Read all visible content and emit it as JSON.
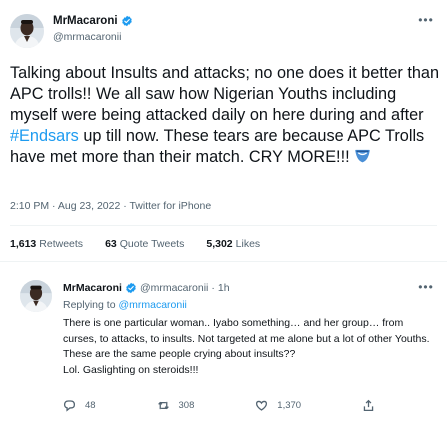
{
  "main_tweet": {
    "author": {
      "name": "MrMacaroni",
      "handle": "@mrmacaronii",
      "verified": true,
      "avatar": "profile-photo-man"
    },
    "text_segments": [
      "Talking about Insults and attacks; no one does it better than APC trolls!! We all saw how Nigerian Youths including myself were being attacked daily on here during and after ",
      "#Endsars",
      " up till now. These tears are because APC Trolls have met more than their match. CRY MORE!!! "
    ],
    "emoji": "crying-face-emoji",
    "timestamp": "2:10 PM · Aug 23, 2022 · Twitter for iPhone",
    "stats": {
      "retweets_count": "1,613",
      "retweets_label": "Retweets",
      "quote_count": "63",
      "quote_label": "Quote Tweets",
      "likes_count": "5,302",
      "likes_label": "Likes"
    }
  },
  "reply_tweet": {
    "author": {
      "name": "MrMacaroni",
      "handle": "@mrmacaronii",
      "time": "1h",
      "verified": true,
      "avatar": "profile-photo-man"
    },
    "replying_label": "Replying to",
    "replying_to": "@mrmacaronii",
    "text_lines": [
      "There is one particular woman.. Iyabo something… and her group… from curses, to attacks, to insults. Not targeted at me alone but a lot of other Youths.",
      "These are the same people crying about insults??",
      "Lol. Gaslighting on steroids!!!"
    ],
    "actions": {
      "replies": "48",
      "retweets": "308",
      "likes": "1,370"
    }
  },
  "colors": {
    "accent": "#1d9bf0",
    "text": "#0f1419",
    "secondary": "#536471",
    "divider": "#eff3f4"
  }
}
